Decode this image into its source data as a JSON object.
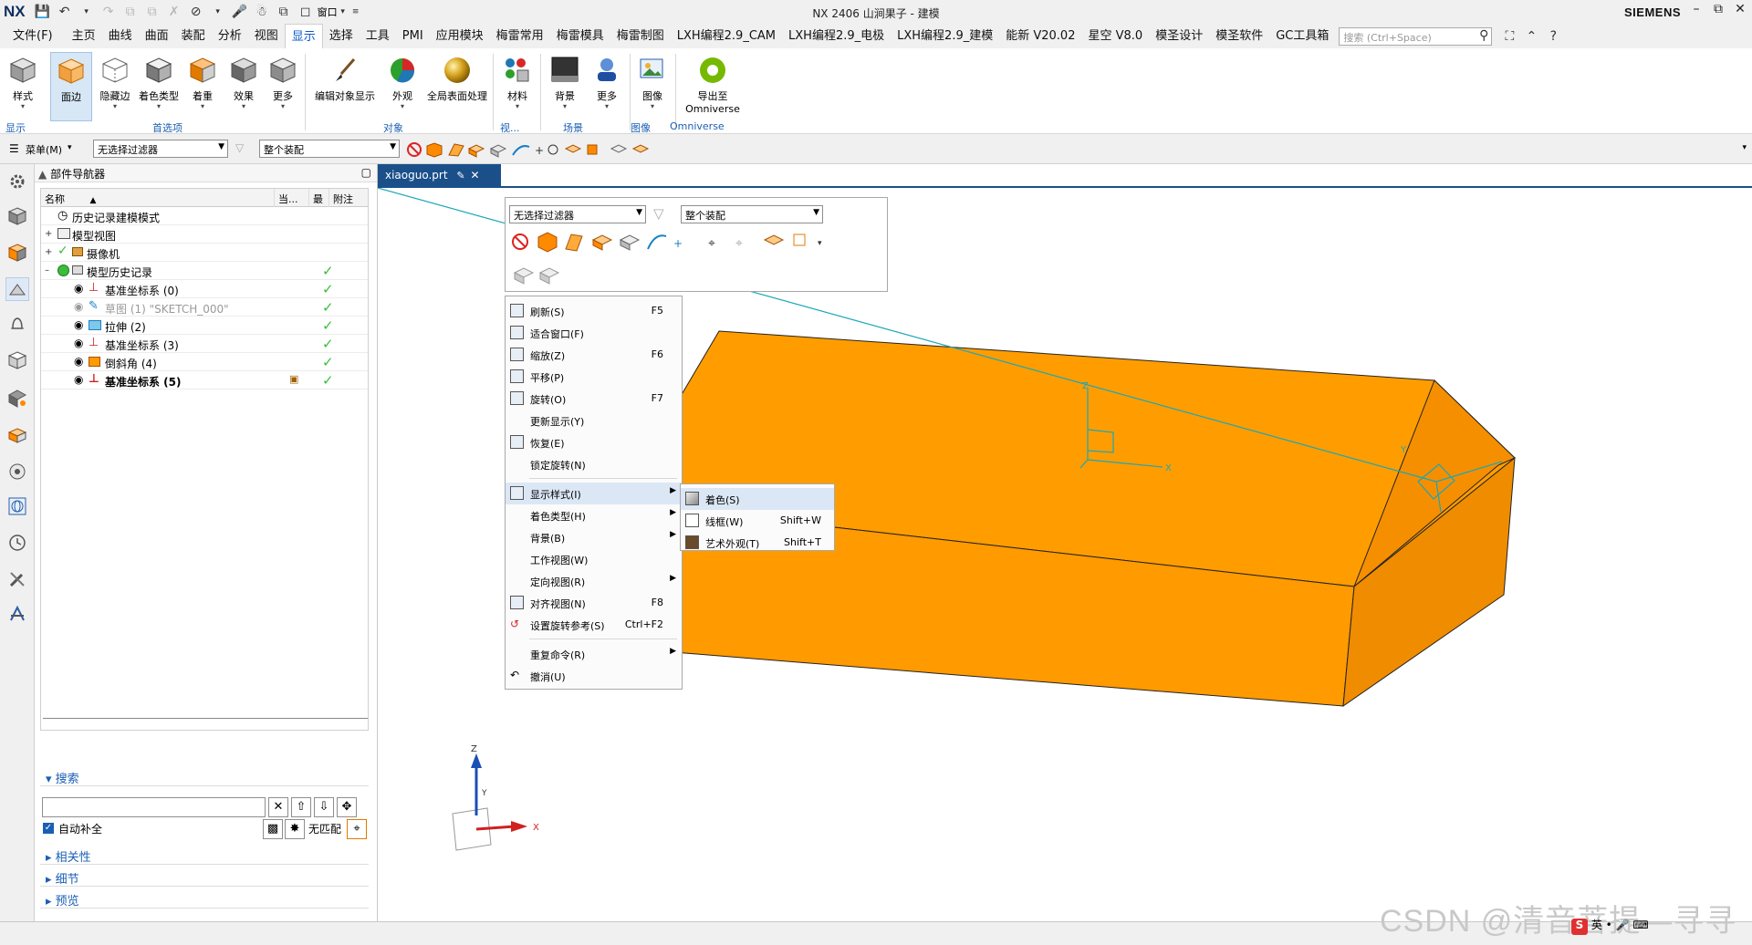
{
  "titlebar": {
    "logo": "NX",
    "title": "NX 2406 山涧果子 - 建模",
    "window_menu": "窗口",
    "brand": "SIEMENS"
  },
  "menubar": {
    "tabs": [
      "文件(F)",
      "主页",
      "曲线",
      "曲面",
      "装配",
      "分析",
      "视图",
      "显示",
      "选择",
      "工具",
      "PMI",
      "应用模块",
      "梅雷常用",
      "梅雷模具",
      "梅雷制图",
      "LXH编程2.9_CAM",
      "LXH编程2.9_电极",
      "LXH编程2.9_建模",
      "能新 V20.02",
      "星空 V8.0",
      "模圣设计",
      "模圣软件",
      "GC工具箱"
    ],
    "active_tab": "显示",
    "search_placeholder": "搜索 (Ctrl+Space)"
  },
  "ribbon": {
    "buttons": [
      "样式",
      "面边",
      "隐藏边",
      "着色类型",
      "着重",
      "效果",
      "更多",
      "编辑对象显示",
      "外观",
      "全局表面处理",
      "材料",
      "背景",
      "更多",
      "图像",
      "导出至"
    ],
    "export_sub": "Omniverse",
    "groups": [
      "显示",
      "首选项",
      "对象",
      "视...",
      "场景",
      "图像",
      "Omniverse"
    ]
  },
  "selbar": {
    "menu_label": "菜单(M)",
    "filter_value": "无选择过滤器",
    "scope_value": "整个装配"
  },
  "navigator": {
    "title": "部件导航器",
    "columns": [
      "名称",
      "当...",
      "最",
      "附注"
    ],
    "rows": [
      {
        "label": "历史记录建模模式",
        "checked": false
      },
      {
        "label": "模型视图",
        "checked": false
      },
      {
        "label": "摄像机",
        "checked": false
      },
      {
        "label": "模型历史记录",
        "checked": true
      },
      {
        "label": "基准坐标系 (0)",
        "checked": true
      },
      {
        "label": "草图 (1) \"SKETCH_000\"",
        "checked": true
      },
      {
        "label": "拉伸 (2)",
        "checked": true
      },
      {
        "label": "基准坐标系 (3)",
        "checked": true
      },
      {
        "label": "倒斜角 (4)",
        "checked": true
      },
      {
        "label": "基准坐标系 (5)",
        "checked": true
      }
    ],
    "search": {
      "title": "搜索",
      "autocomplete": "自动补全",
      "no_match": "无匹配",
      "sections": [
        "相关性",
        "细节",
        "预览"
      ]
    }
  },
  "doc_tab": "xiaoguo.prt",
  "popup": {
    "filter_value": "无选择过滤器",
    "scope_value": "整个装配"
  },
  "context_menu": {
    "items": [
      {
        "label": "刷新(S)",
        "key": "F5"
      },
      {
        "label": "适合窗口(F)",
        "key": ""
      },
      {
        "label": "缩放(Z)",
        "key": "F6"
      },
      {
        "label": "平移(P)",
        "key": ""
      },
      {
        "label": "旋转(O)",
        "key": "F7"
      },
      {
        "label": "更新显示(Y)",
        "key": ""
      },
      {
        "label": "恢复(E)",
        "key": ""
      },
      {
        "label": "锁定旋转(N)",
        "key": ""
      },
      {
        "label": "显示样式(I)",
        "key": ""
      },
      {
        "label": "着色类型(H)",
        "key": ""
      },
      {
        "label": "背景(B)",
        "key": ""
      },
      {
        "label": "工作视图(W)",
        "key": ""
      },
      {
        "label": "定向视图(R)",
        "key": ""
      },
      {
        "label": "对齐视图(N)",
        "key": "F8"
      },
      {
        "label": "设置旋转参考(S)",
        "key": "Ctrl+F2"
      },
      {
        "label": "重复命令(R)",
        "key": ""
      },
      {
        "label": "撤消(U)",
        "key": ""
      }
    ]
  },
  "submenu": {
    "items": [
      {
        "label": "着色(S)",
        "key": ""
      },
      {
        "label": "线框(W)",
        "key": "Shift+W"
      },
      {
        "label": "艺术外观(T)",
        "key": "Shift+T"
      }
    ]
  },
  "triad": {
    "x": "X",
    "y": "Y",
    "z": "Z"
  },
  "watermark": "CSDN @清音菩提—寻寻",
  "ime": "英",
  "colors": {
    "accent": "#1a5fb4",
    "model": "#ff9a00",
    "tab": "#1a4f8a",
    "check": "#3cbc3c"
  }
}
